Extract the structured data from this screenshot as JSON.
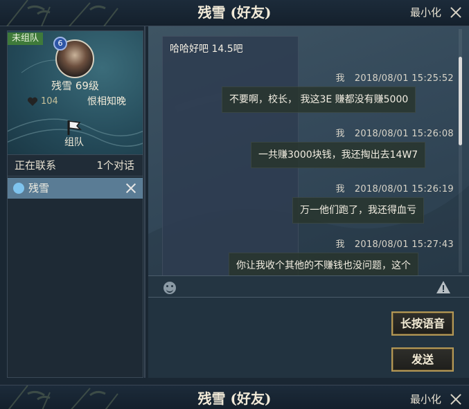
{
  "window": {
    "title": "残雪 (好友)",
    "minimize_label": "最小化",
    "close_icon": "close-icon"
  },
  "profile": {
    "team_status": "未组队",
    "role_badge": "6",
    "name_level": "残雪  69级",
    "intimacy": "104",
    "relation": "恨相知晚",
    "team_button_label": "组队"
  },
  "contacts": {
    "header_left": "正在联系",
    "header_right": "1个对话",
    "items": [
      {
        "name": "残雪"
      }
    ]
  },
  "messages": [
    {
      "side": "left",
      "text": "哈哈好吧  14.5吧"
    },
    {
      "side": "right",
      "sender": "我",
      "time": "2018/08/01  15:25:52",
      "text": "不要啊，校长，  我这3E  赚都没有赚5000"
    },
    {
      "side": "right",
      "sender": "我",
      "time": "2018/08/01  15:26:08",
      "text": "一共赚3000块钱，我还掏出去14W7"
    },
    {
      "side": "right",
      "sender": "我",
      "time": "2018/08/01  15:26:19",
      "text": "万一他们跑了，我还得血亏"
    },
    {
      "side": "right",
      "sender": "我",
      "time": "2018/08/01  15:27:43",
      "text": "你让我收个其他的不赚钱也没问题，这个"
    }
  ],
  "input": {
    "emoji_icon": "emoji-icon",
    "warning_icon": "warning-icon"
  },
  "buttons": {
    "voice_label": "长按语音",
    "send_label": "发送"
  },
  "colors": {
    "team_tag": "#3f7a3a",
    "selected_chat": "#5a7c95",
    "button_border": "#b49856"
  }
}
